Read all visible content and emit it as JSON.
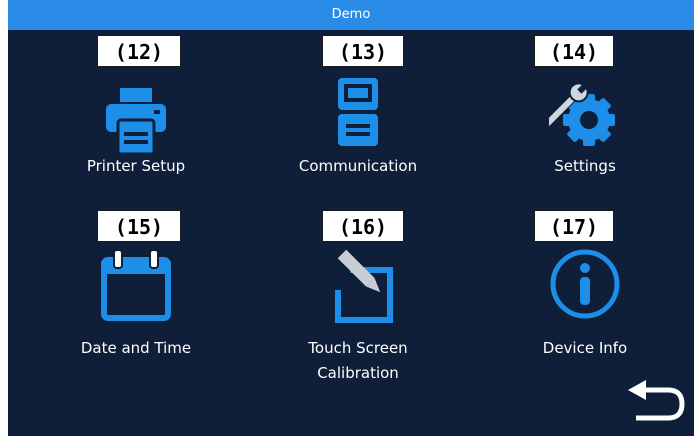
{
  "window": {
    "title": "Demo"
  },
  "colors": {
    "titlebar": "#2a8be6",
    "background": "#0f1f3a",
    "icon": "#1e8fe8",
    "text": "#ffffff"
  },
  "menu": [
    {
      "label": "Printer Setup",
      "icon": "printer-icon"
    },
    {
      "label": "Communication",
      "icon": "communication-icon"
    },
    {
      "label": "Settings",
      "icon": "settings-icon"
    },
    {
      "label": "Date and Time",
      "icon": "calendar-icon"
    },
    {
      "label": "Touch Screen Calibration",
      "label_line1": "Touch Screen",
      "label_line2": "Calibration",
      "icon": "calibration-icon"
    },
    {
      "label": "Device Info",
      "icon": "info-icon"
    }
  ],
  "callouts": [
    "(12)",
    "(13)",
    "(14)",
    "(15)",
    "(16)",
    "(17)"
  ],
  "back": {
    "icon": "back-arrow-icon"
  }
}
